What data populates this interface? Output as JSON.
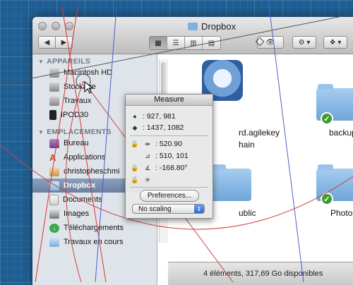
{
  "window": {
    "title": "Dropbox"
  },
  "toolbar": {
    "back": "◀",
    "forward": "▶",
    "eye": "👁",
    "gear": "⚙ ▾",
    "dropbox": "❖ ▾"
  },
  "sidebar": {
    "devices_header": "APPAREILS",
    "devices": [
      "Macintosh HD",
      "Stockage",
      "Travaux",
      "IPOD30"
    ],
    "places_header": "EMPLACEMENTS",
    "places": [
      "Bureau",
      "Applications",
      "christopheschmi",
      "Dropbox",
      "Documents",
      "Images",
      "Téléchargements",
      "Travaux en cours"
    ],
    "selected": "Dropbox"
  },
  "files": [
    {
      "name": "rd.agilekey",
      "name2": "hain"
    },
    {
      "name": "backup"
    },
    {
      "name": "ublic"
    },
    {
      "name": "Photos"
    }
  ],
  "status": "4 éléments, 317,69 Go disponibles",
  "measure": {
    "title": "Measure",
    "point1": ": 927, 981",
    "point2": ": 1437, 1082",
    "distance": ": 520.90",
    "delta": ": 510, 101",
    "angle": ": -168.80°",
    "preferences": "Preferences...",
    "scaling": "No scaling"
  },
  "colors": {
    "desktop": "#1f5e93",
    "sidebar": "#dfe4ea",
    "selection": "#6a81a3",
    "check": "#3d9b2f"
  }
}
